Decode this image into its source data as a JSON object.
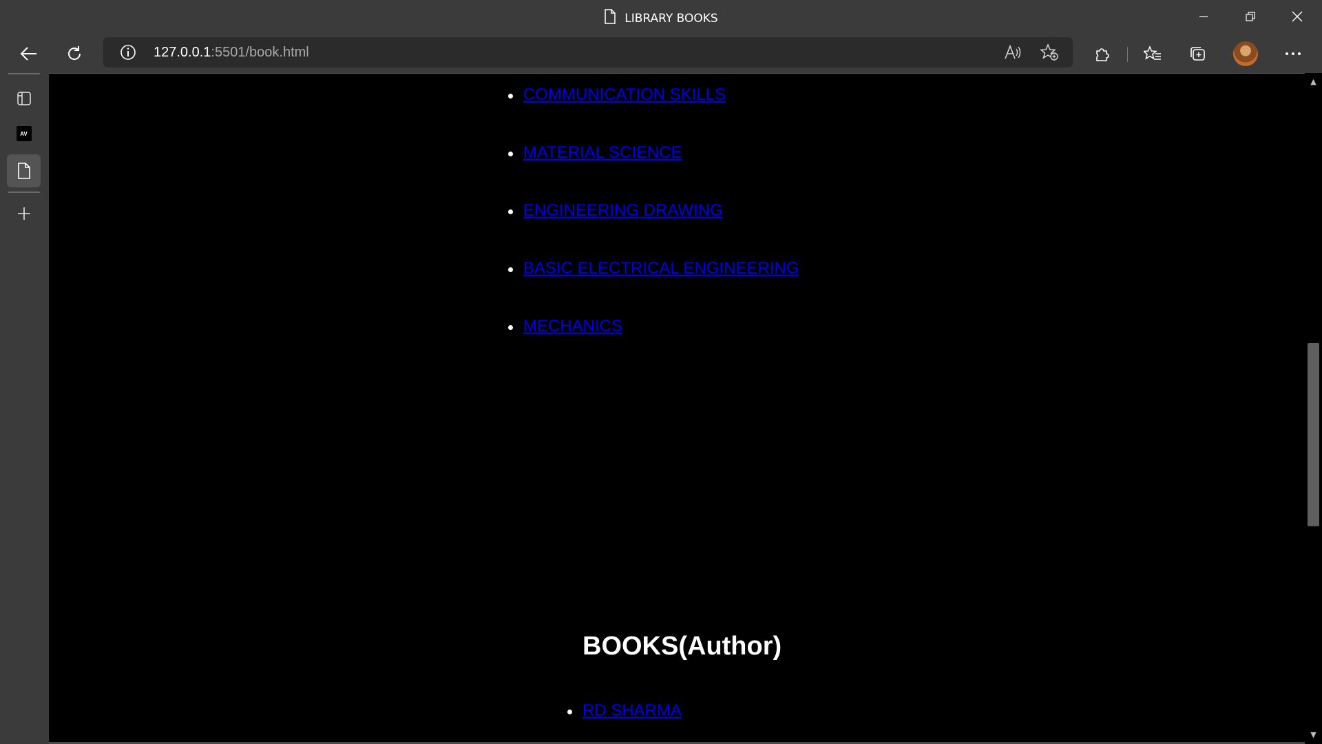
{
  "window": {
    "title": "LIBRARY BOOKS",
    "icons": {
      "minimize": "minimize-icon",
      "maximize": "restore-icon",
      "close": "close-icon"
    }
  },
  "toolbar": {
    "address_host": "127.0.0.1",
    "address_rest": ":5501/book.html",
    "icons": [
      "back-icon",
      "refresh-icon",
      "info-icon",
      "read-aloud-icon",
      "add-favorite-icon",
      "extensions-icon",
      "favorites-icon",
      "collections-icon",
      "profile-avatar",
      "more-icon"
    ]
  },
  "sidebar": {
    "items": [
      "tab-actions-icon",
      "av-tab",
      "page-tab-icon",
      "new-tab-icon"
    ],
    "av_label": "AV"
  },
  "page": {
    "subjects": [
      "COMMUNICATION SKILLS",
      "MATERIAL SCIENCE",
      "ENGINEERING DRAWING",
      "BASIC ELECTRICAL ENGINEERING",
      "MECHANICS"
    ],
    "authors_heading": "BOOKS(Author)",
    "authors": [
      "RD SHARMA"
    ],
    "link_color": "#0000ee",
    "background": "#000000"
  },
  "scroll": {
    "position_fraction": 0.45
  }
}
